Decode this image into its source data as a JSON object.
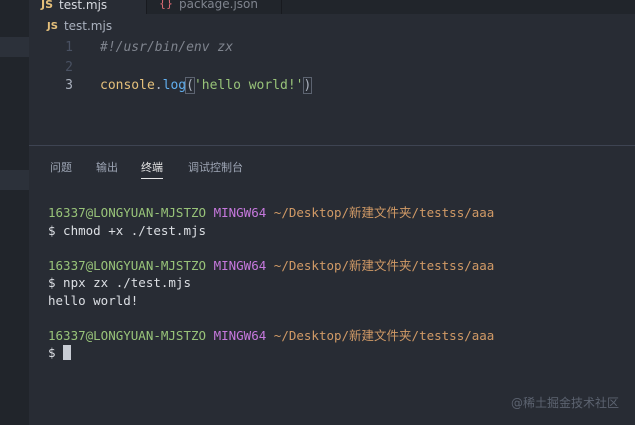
{
  "tabs": [
    {
      "badge": "JS",
      "label": "test.mjs",
      "active": true
    },
    {
      "badge": "{}",
      "label": "package.json",
      "active": false
    }
  ],
  "breadcrumb": {
    "badge": "JS",
    "file": "test.mjs"
  },
  "editor": {
    "lines": [
      {
        "num": "1",
        "text": "#!/usr/bin/env zx"
      },
      {
        "num": "2",
        "text": ""
      },
      {
        "num": "3",
        "obj": "console",
        "dot": ".",
        "fn": "log",
        "open": "(",
        "str": "'hello world!'",
        "close": ")"
      }
    ]
  },
  "panel": {
    "tabs": [
      "问题",
      "输出",
      "终端",
      "调试控制台"
    ],
    "active_tab": "终端"
  },
  "terminal": {
    "prompts": [
      {
        "user": "16337@LONGYUAN-MJSTZO",
        "host": "MINGW64",
        "path": "~/Desktop/新建文件夹/testss/aaa",
        "command": "$ chmod +x ./test.mjs"
      },
      {
        "user": "16337@LONGYUAN-MJSTZO",
        "host": "MINGW64",
        "path": "~/Desktop/新建文件夹/testss/aaa",
        "command": "$ npx zx ./test.mjs",
        "output": "hello world!"
      },
      {
        "user": "16337@LONGYUAN-MJSTZO",
        "host": "MINGW64",
        "path": "~/Desktop/新建文件夹/testss/aaa",
        "command": "$ "
      }
    ]
  },
  "watermark": "@稀土掘金技术社区",
  "colors": {
    "accent": "#528bff",
    "string": "#98c379",
    "function": "#61afef",
    "object": "#e5c07b",
    "host": "#c678dd",
    "path": "#d19a66"
  }
}
